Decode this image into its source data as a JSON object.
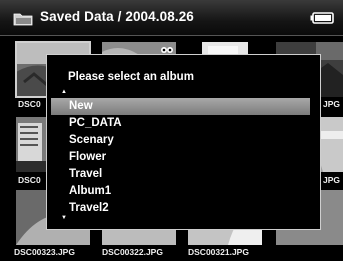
{
  "header": {
    "title": "Saved Data / 2004.08.26",
    "folder_icon": "folder-icon",
    "battery_icon": "battery-icon"
  },
  "thumbnails": {
    "row1": {
      "left_label": "DSC0",
      "right_label": "JPG"
    },
    "row2": {
      "left_label": "DSC0",
      "right_label": "JPG"
    },
    "row3": [
      "DSC00323.JPG",
      "DSC00322.JPG",
      "DSC00321.JPG"
    ]
  },
  "dialog": {
    "title": "Please select an album",
    "scroll_up_icon": "triangle-up-icon",
    "scroll_down_icon": "triangle-down-icon",
    "albums": [
      "New",
      "PC_DATA",
      "Scenary",
      "Flower",
      "Travel",
      "Album1",
      "Travel2"
    ],
    "selected_index": 0
  },
  "colors": {
    "highlight": "#8e8e8e",
    "background": "#000000",
    "text": "#ffffff"
  }
}
